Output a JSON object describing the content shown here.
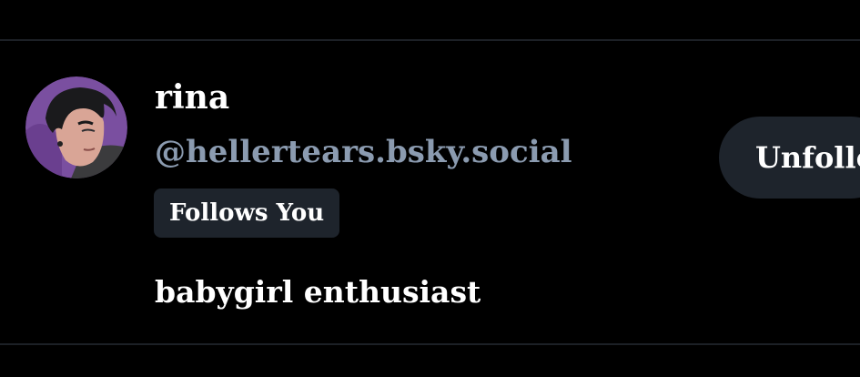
{
  "profile": {
    "display_name": "rina",
    "handle": "@hellertears.bsky.social",
    "badge": "Follows You",
    "bio": "babygirl enthusiast"
  },
  "actions": {
    "unfollow_label": "Unfollow"
  },
  "icons": {
    "avatar": "avatar-illustration"
  },
  "colors": {
    "background": "#000000",
    "divider": "#1c2026",
    "handle": "#8b9bb0",
    "chip": "#1e242c",
    "text": "#ffffff"
  }
}
